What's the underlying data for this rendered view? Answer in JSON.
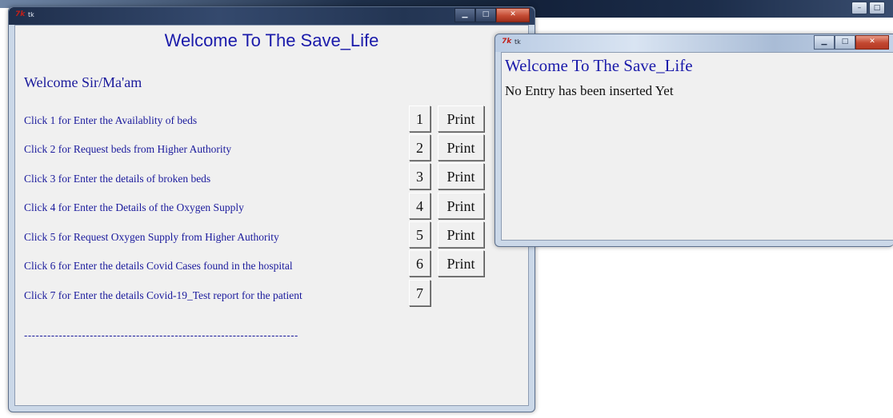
{
  "main_window": {
    "title": "tk",
    "heading": "Welcome To The Save_Life",
    "welcome": "Welcome Sir/Ma'am",
    "rows": [
      {
        "label": "Click 1 for Enter the Availablity of beds",
        "num": "1",
        "print": "Print"
      },
      {
        "label": "Click 2 for Request beds from Higher Authority",
        "num": "2",
        "print": "Print"
      },
      {
        "label": "Click 3 for Enter the details of broken beds",
        "num": "3",
        "print": "Print"
      },
      {
        "label": "Click 4 for Enter the Details of the Oxygen Supply",
        "num": "4",
        "print": "Print"
      },
      {
        "label": "Click 5 for Request Oxygen Supply from Higher Authority",
        "num": "5",
        "print": "Print"
      },
      {
        "label": "Click 6 for Enter the details Covid Cases found in the hospital",
        "num": "6",
        "print": "Print"
      },
      {
        "label": "Click 7 for Enter the details Covid-19_Test report for the patient",
        "num": "7"
      }
    ],
    "separator": "-----------------------------------------------------------------------"
  },
  "popup_window": {
    "title": "tk",
    "heading": "Welcome To The Save_Life",
    "message": "No Entry has been inserted Yet"
  },
  "icons": {
    "app_icon": "tk-feather-icon",
    "minimize": "minimize-icon",
    "maximize": "maximize-icon",
    "close": "close-icon"
  },
  "colors": {
    "label_text": "#1a1a9c",
    "heading_text": "#1a1aaa",
    "client_bg": "#f0f0f0",
    "close_button": "#c24730"
  }
}
